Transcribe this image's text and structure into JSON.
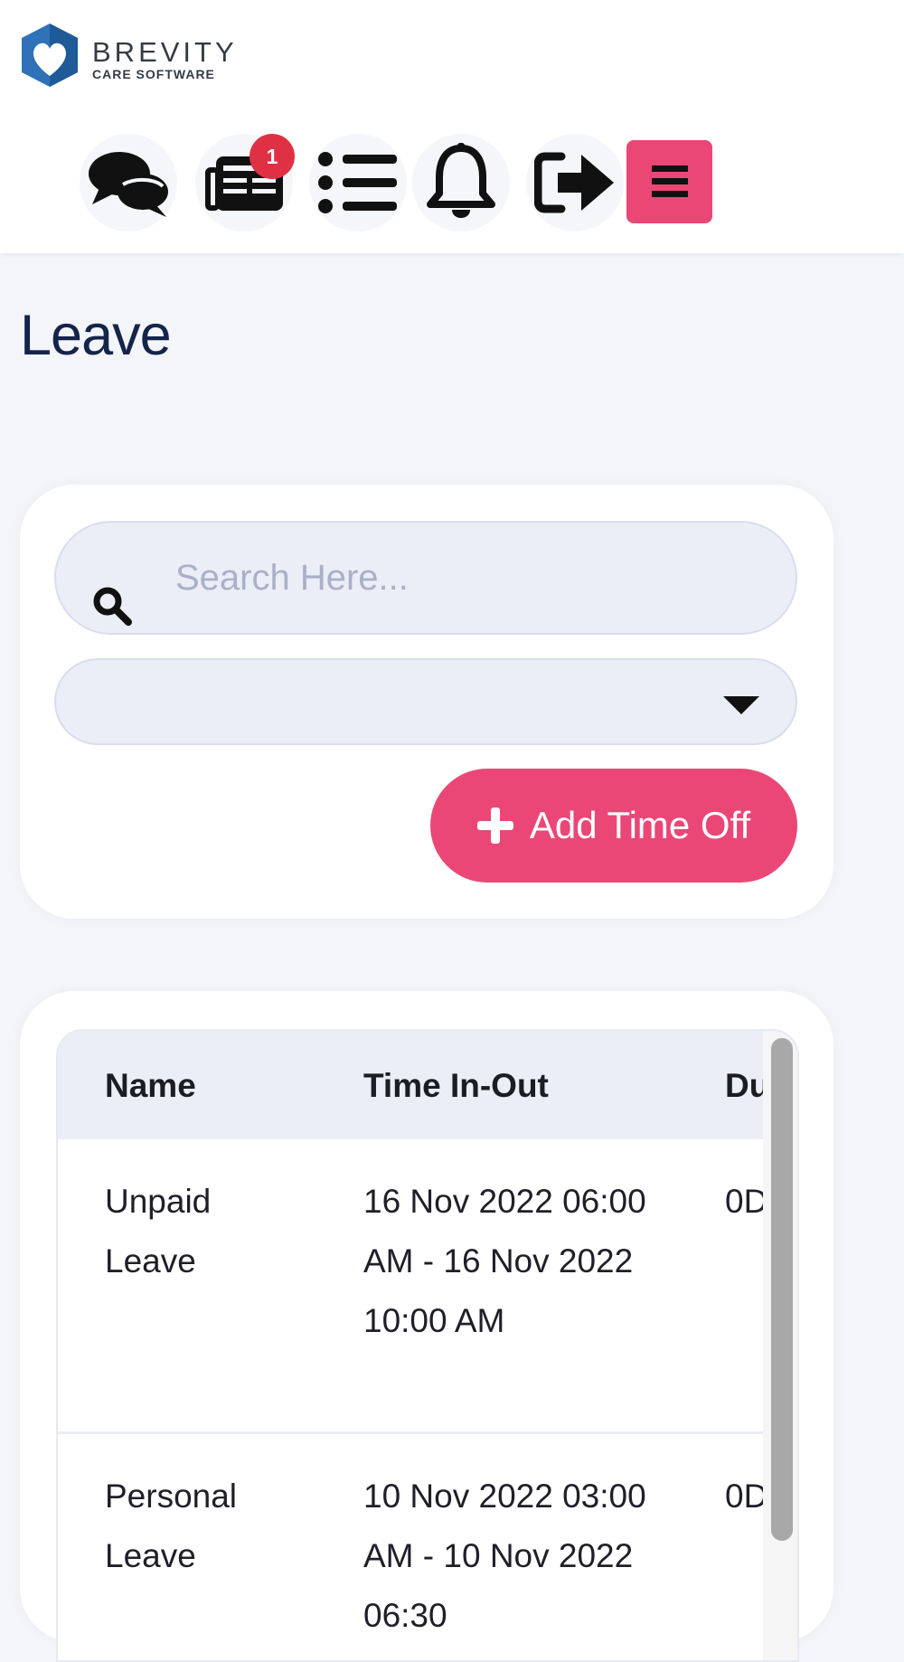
{
  "brand": {
    "title": "BREVITY",
    "subtitle": "CARE SOFTWARE",
    "colors": {
      "primary": "#ea4777",
      "navy": "#14244a",
      "logo_blue": "#2f72b8"
    }
  },
  "header": {
    "icons": [
      {
        "name": "chat-icon"
      },
      {
        "name": "newspaper-icon",
        "badge": "1"
      },
      {
        "name": "list-icon"
      },
      {
        "name": "bell-icon"
      },
      {
        "name": "sign-out-icon"
      }
    ],
    "menu_icon": "hamburger-icon"
  },
  "page": {
    "title": "Leave"
  },
  "filters": {
    "search_placeholder": "Search Here...",
    "select_value": "",
    "add_button_label": "Add Time Off"
  },
  "table": {
    "columns": [
      "Name",
      "Time In-Out",
      "Du"
    ],
    "rows": [
      {
        "name": "Unpaid Leave",
        "time": "16 Nov 2022 06:00 AM - 16 Nov 2022 10:00 AM",
        "duration": "0D"
      },
      {
        "name": "Personal Leave",
        "time": "10 Nov 2022 03:00 AM - 10 Nov 2022 06:30",
        "duration": "0D"
      }
    ]
  }
}
